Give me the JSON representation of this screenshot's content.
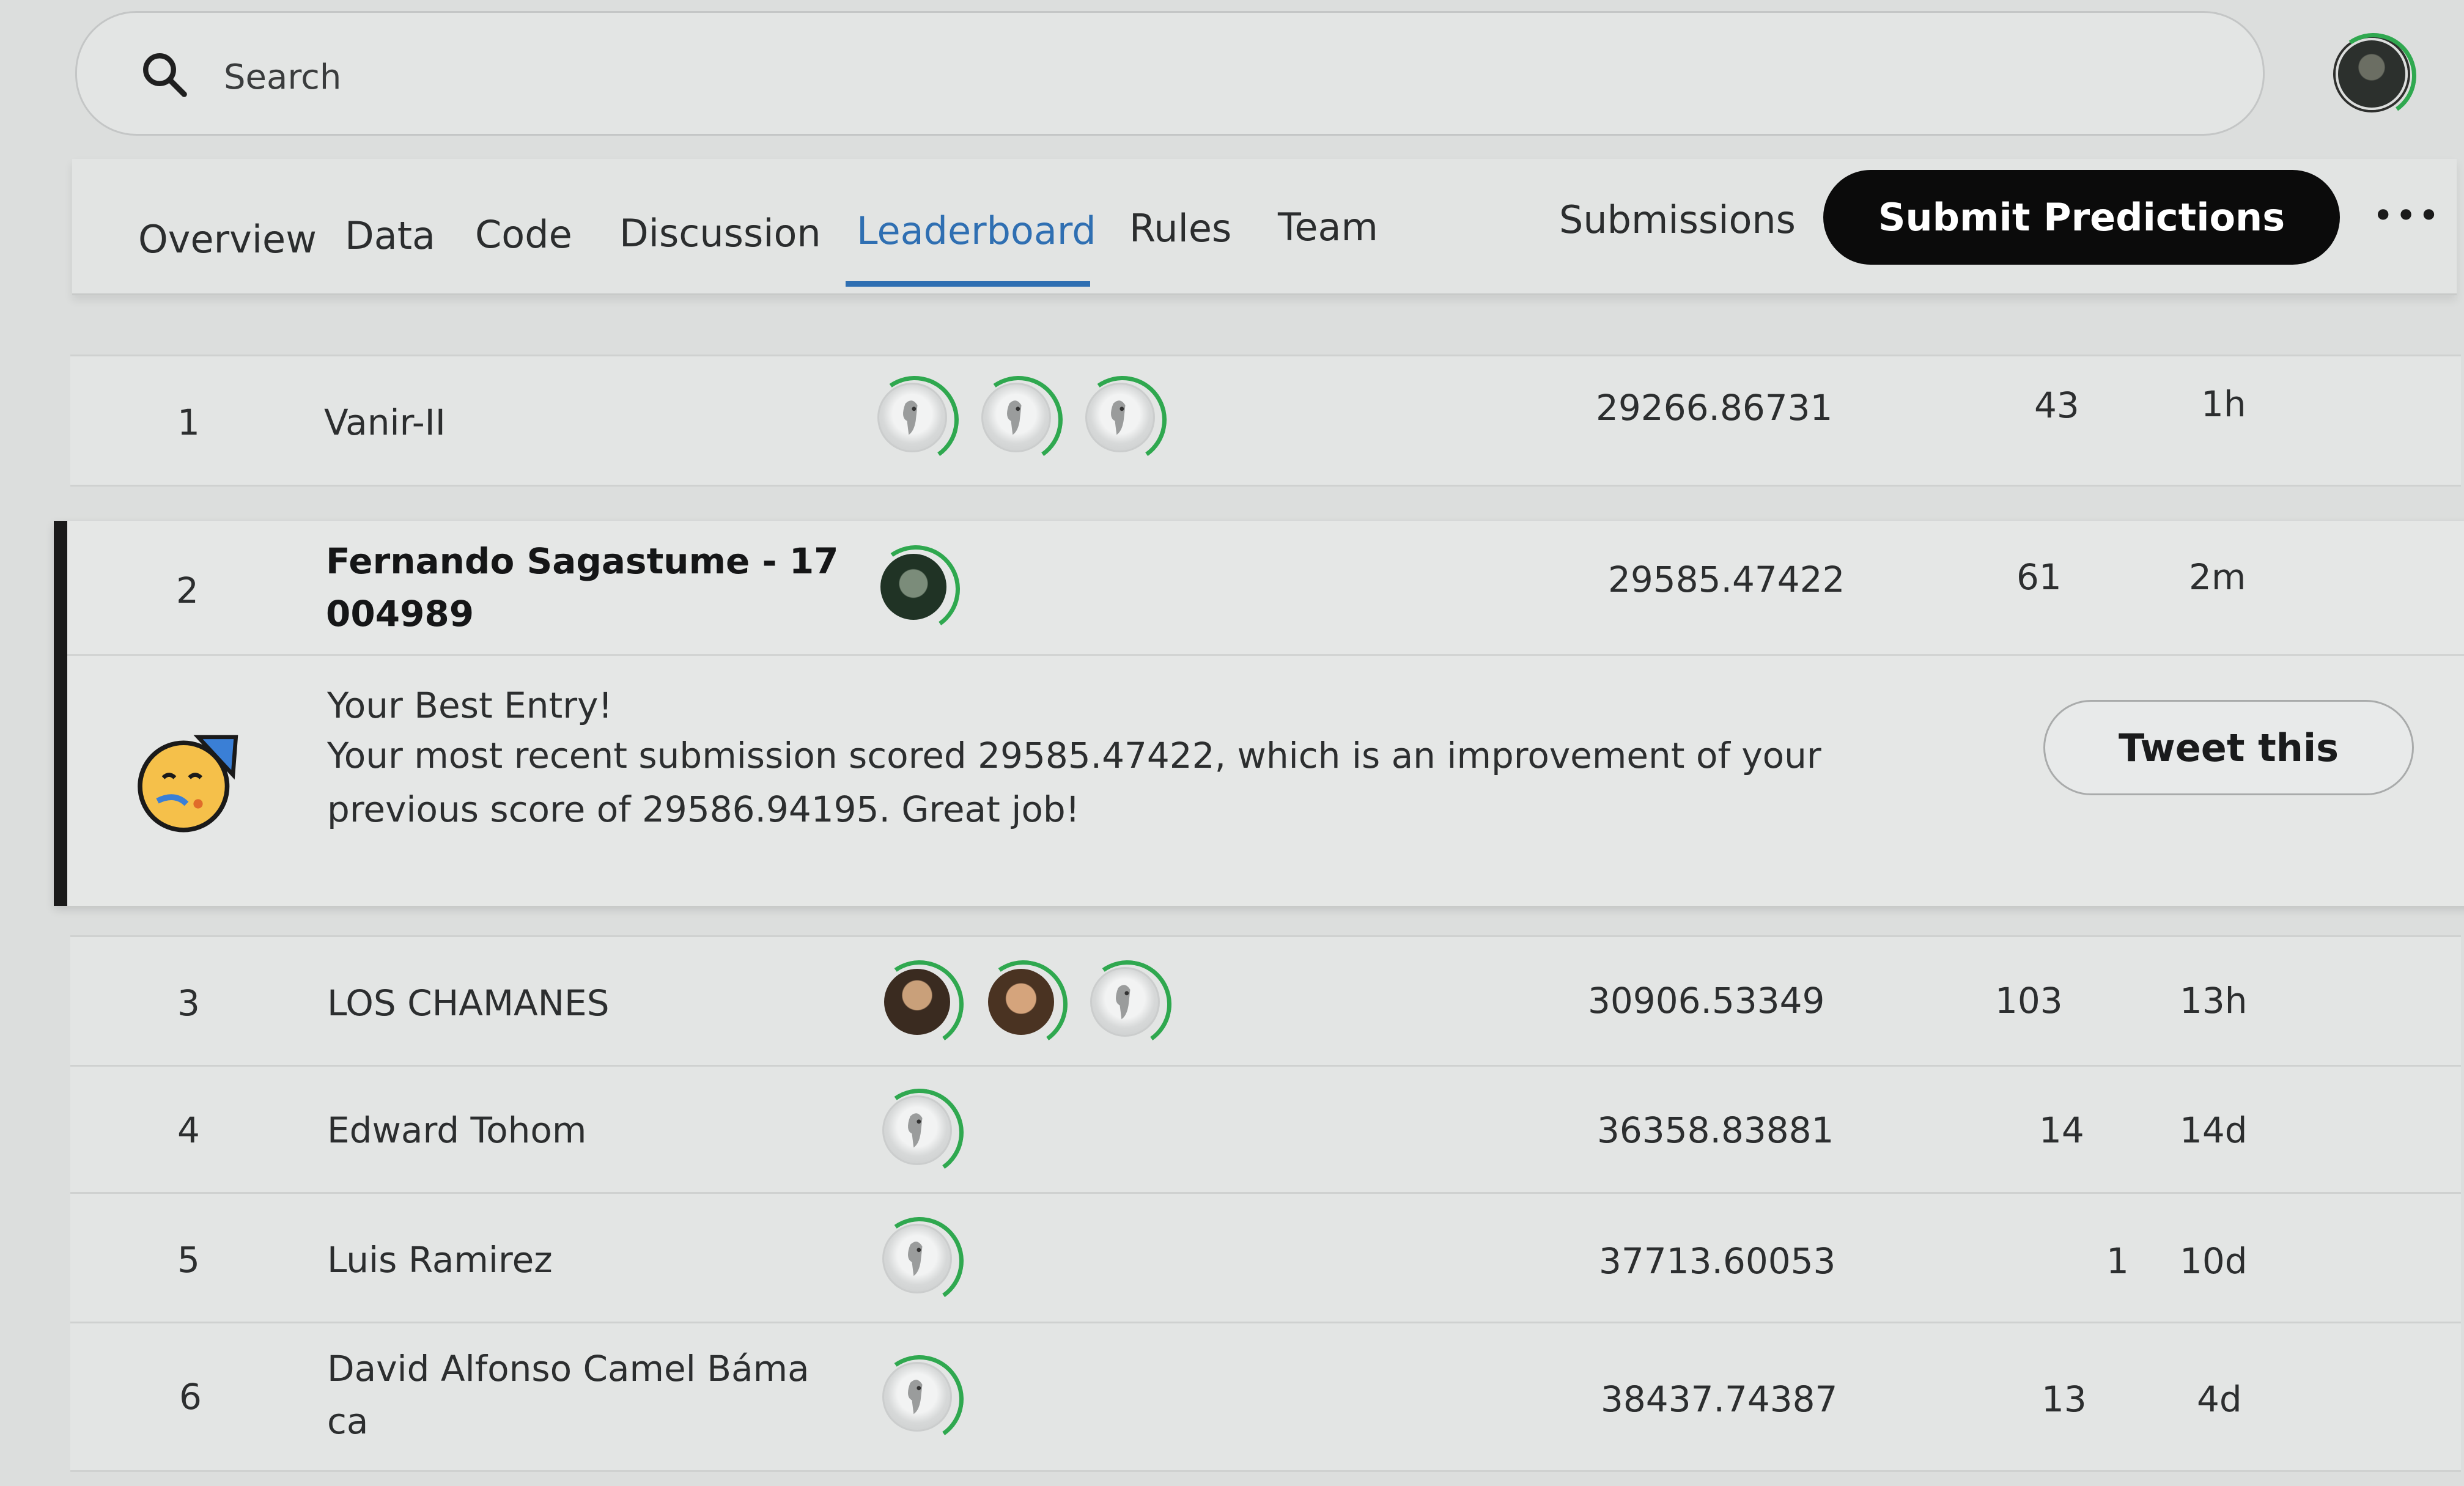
{
  "search": {
    "placeholder": "Search"
  },
  "nav": {
    "tabs": [
      {
        "label": "Overview"
      },
      {
        "label": "Data"
      },
      {
        "label": "Code"
      },
      {
        "label": "Discussion"
      },
      {
        "label": "Leaderboard",
        "active": true
      },
      {
        "label": "Rules"
      },
      {
        "label": "Team"
      }
    ],
    "submissions_label": "Submissions",
    "submit_label": "Submit Predictions",
    "more_label": "•••"
  },
  "leaderboard": {
    "rows": [
      {
        "rank": "1",
        "team": "Vanir-II",
        "score": "29266.86731",
        "entries": "43",
        "last": "1h"
      },
      {
        "rank": "2",
        "team": "Fernando Sagastume - 17",
        "team_line2": "004989",
        "score": "29585.47422",
        "entries": "61",
        "last": "2m"
      },
      {
        "rank": "3",
        "team": "LOS CHAMANES",
        "score": "30906.53349",
        "entries": "103",
        "last": "13h"
      },
      {
        "rank": "4",
        "team": "Edward Tohom",
        "score": "36358.83881",
        "entries": "14",
        "last": "14d"
      },
      {
        "rank": "5",
        "team": "Luis Ramirez",
        "score": "37713.60053",
        "entries": "1",
        "last": "10d"
      },
      {
        "rank": "6",
        "team": "David Alfonso Camel Báma",
        "team_line2": "ca",
        "score": "38437.74387",
        "entries": "13",
        "last": "4d"
      }
    ]
  },
  "best_entry": {
    "title": "Your Best Entry!",
    "line1": "Your most recent submission scored 29585.47422, which is an improvement of your",
    "line2": "previous score of 29586.94195. Great job!",
    "tweet_label": "Tweet this"
  },
  "colors": {
    "accent": "#2f6fb2",
    "ring": "#2fa84f",
    "button_bg": "#0b0b0b"
  },
  "icons": [
    "search-icon",
    "celebration-emoji-icon",
    "user-avatar-default-icon"
  ]
}
